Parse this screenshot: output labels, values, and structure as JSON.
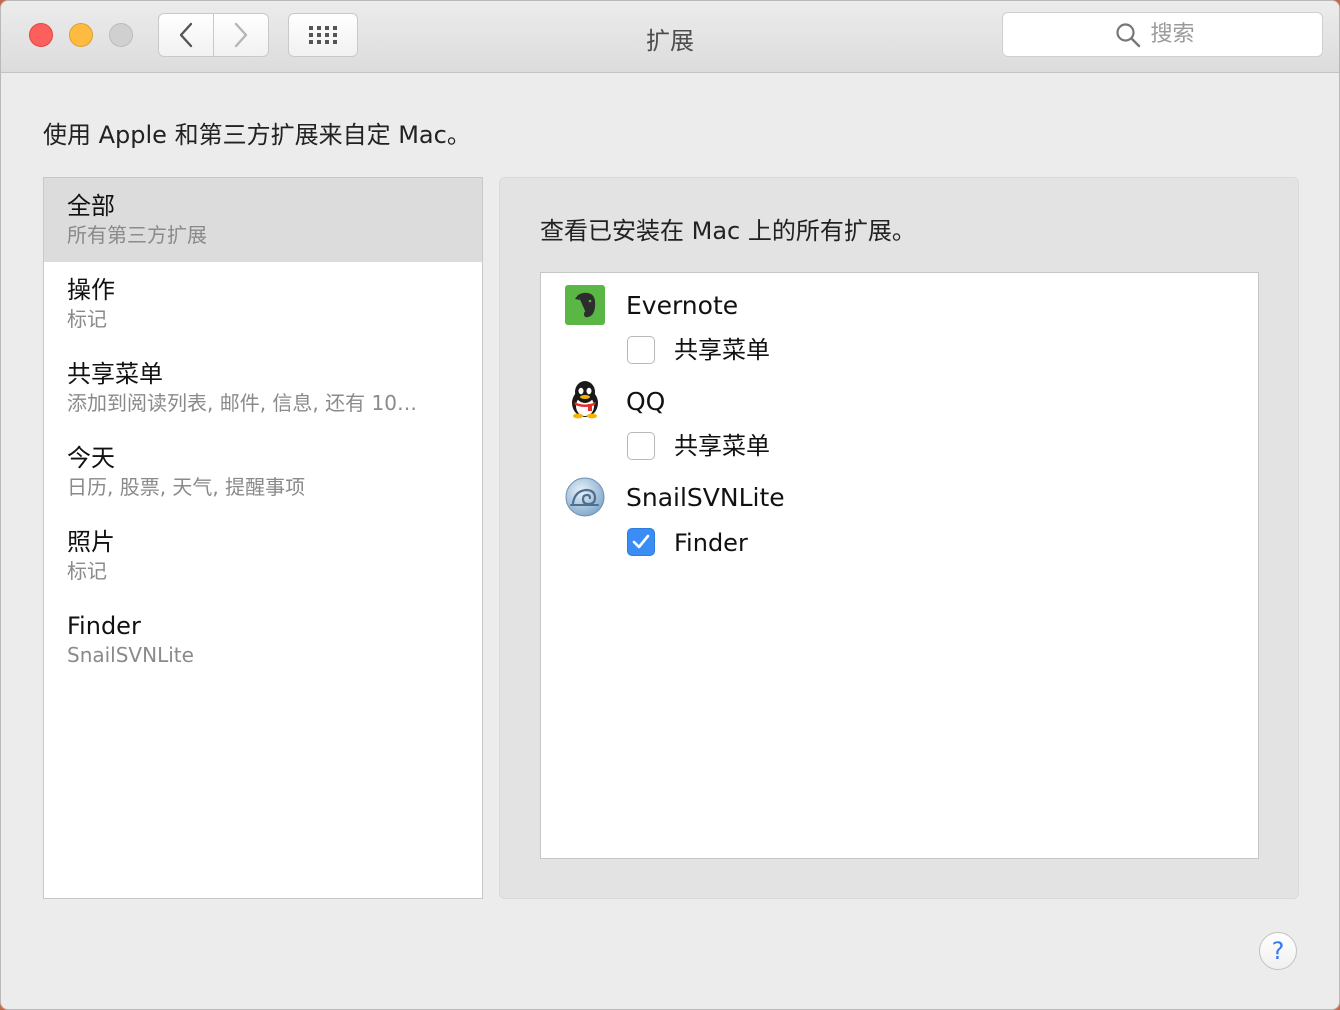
{
  "window": {
    "title": "扩展",
    "search": {
      "placeholder": "搜索"
    }
  },
  "header": {
    "description": "使用 Apple 和第三方扩展来自定 Mac。"
  },
  "sidebar": {
    "items": [
      {
        "title": "全部",
        "subtitle": "所有第三方扩展",
        "selected": true
      },
      {
        "title": "操作",
        "subtitle": "标记"
      },
      {
        "title": "共享菜单",
        "subtitle": "添加到阅读列表, 邮件, 信息, 还有 10…"
      },
      {
        "title": "今天",
        "subtitle": "日历, 股票, 天气, 提醒事项"
      },
      {
        "title": "照片",
        "subtitle": "标记"
      },
      {
        "title": "Finder",
        "subtitle": "SnailSVNLite"
      }
    ]
  },
  "main": {
    "description": "查看已安装在 Mac 上的所有扩展。",
    "apps": [
      {
        "name": "Evernote",
        "icon": "evernote-icon",
        "extension": "共享菜单",
        "checked": false
      },
      {
        "name": "QQ",
        "icon": "qq-icon",
        "extension": "共享菜单",
        "checked": false
      },
      {
        "name": "SnailSVNLite",
        "icon": "snailsvn-icon",
        "extension": "Finder",
        "checked": true
      }
    ]
  },
  "help": {
    "label": "?"
  },
  "colors": {
    "accent": "#3b8df6",
    "selection": "#dcdcdc",
    "close": "#fc605c",
    "minimize": "#fdbc40"
  }
}
